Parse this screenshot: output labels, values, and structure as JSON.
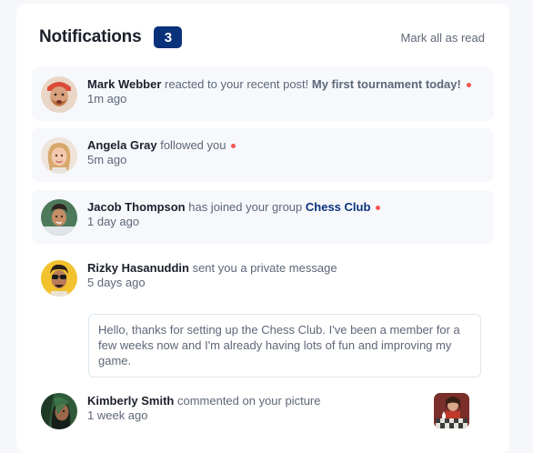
{
  "header": {
    "title": "Notifications",
    "unread_count": "3",
    "mark_all_label": "Mark all as read"
  },
  "notifications": [
    {
      "name": "Mark Webber",
      "action": " reacted to your recent post! ",
      "target": "My first tournament today!",
      "time": "1m ago",
      "unread": true,
      "avatar_icon": "avatar-mark-webber"
    },
    {
      "name": "Angela Gray",
      "action": " followed you",
      "target": "",
      "time": "5m ago",
      "unread": true,
      "avatar_icon": "avatar-angela-gray"
    },
    {
      "name": "Jacob Thompson",
      "action": " has joined your group ",
      "target": "Chess Club",
      "time": "1 day ago",
      "unread": true,
      "avatar_icon": "avatar-jacob-thompson"
    },
    {
      "name": "Rizky Hasanuddin",
      "action": " sent you a private message",
      "target": "",
      "time": "5 days ago",
      "unread": false,
      "avatar_icon": "avatar-rizky-hasanuddin",
      "message": "Hello, thanks for setting up the Chess Club. I've been a member for a few weeks now and I'm already having lots of fun and improving my game."
    },
    {
      "name": "Kimberly Smith",
      "action": " commented on your picture",
      "target": "",
      "time": "1 week ago",
      "unread": false,
      "avatar_icon": "avatar-kimberly-smith",
      "picture_icon": "chess-picture-thumbnail"
    }
  ],
  "colors": {
    "accent": "#0a327b",
    "unread_dot": "#f65552",
    "unread_bg": "#f6f8fc",
    "text_dark": "#1c202b",
    "text_muted": "#5e6778"
  }
}
